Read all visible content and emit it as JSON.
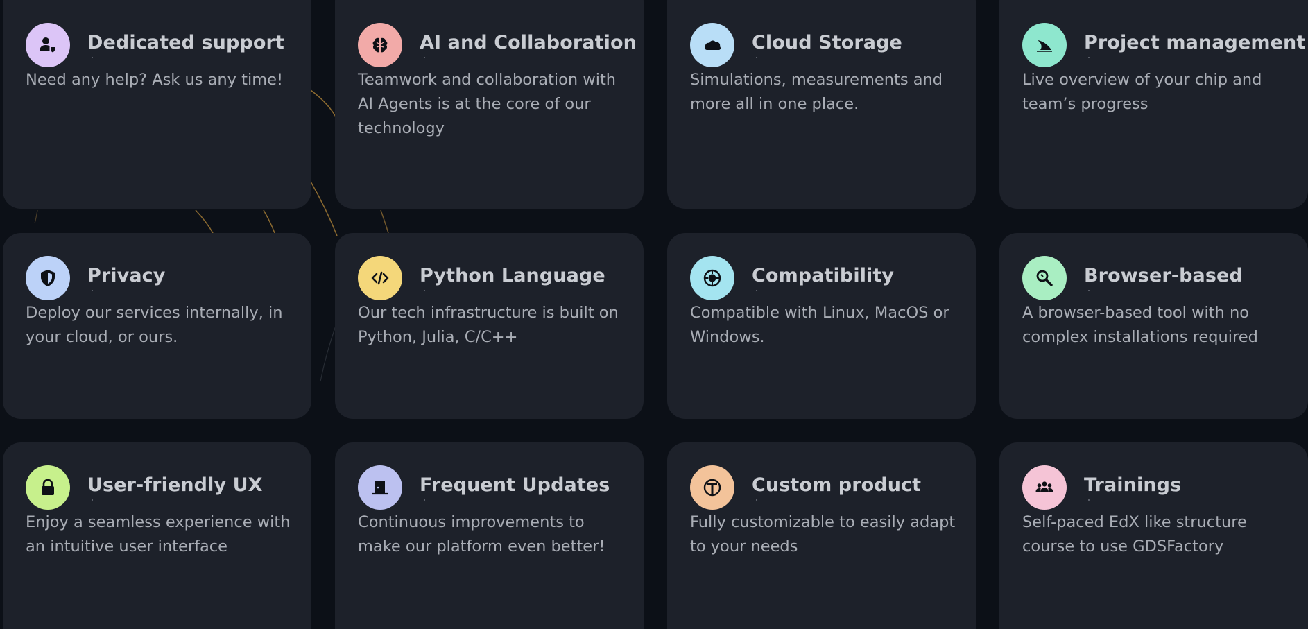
{
  "features": [
    {
      "title": "Dedicated support",
      "desc": "Need any help? Ask us any time!",
      "icon": "user-support-icon",
      "icon_bg": "#dcc5f7"
    },
    {
      "title": "AI and Collaboration",
      "desc": "Teamwork and collaboration with AI Agents is at the core of our technology",
      "icon": "brain-icon",
      "icon_bg": "#f2aaa8"
    },
    {
      "title": "Cloud Storage",
      "desc": "Simulations, measurements and more all in one place.",
      "icon": "cloud-icon",
      "icon_bg": "#b9def7"
    },
    {
      "title": "Project management",
      "desc": "Live overview of your chip and team’s progress",
      "icon": "shark-fin-icon",
      "icon_bg": "#8ee7ce"
    },
    {
      "title": "Privacy",
      "desc": "Deploy our services internally, in your cloud, or ours.",
      "icon": "shield-icon",
      "icon_bg": "#bcd2f8"
    },
    {
      "title": "Python Language",
      "desc": "Our tech infrastructure is built on Python, Julia, C/C++",
      "icon": "code-icon",
      "icon_bg": "#f4d77a"
    },
    {
      "title": "Compatibility",
      "desc": "Compatible with Linux, MacOS or Windows.",
      "icon": "chip-icon",
      "icon_bg": "#a4e4f0"
    },
    {
      "title": "Browser-based",
      "desc": "A browser-based tool with no complex installations required",
      "icon": "search-icon",
      "icon_bg": "#a9eec2"
    },
    {
      "title": "User-friendly UX",
      "desc": "Enjoy a seamless experience with an intuitive user interface",
      "icon": "lock-icon",
      "icon_bg": "#c7f08c"
    },
    {
      "title": "Frequent Updates",
      "desc": "Continuous improvements to make our platform even better!",
      "icon": "door-icon",
      "icon_bg": "#bcc1f0"
    },
    {
      "title": "Custom product",
      "desc": "Fully customizable to easily adapt to your needs",
      "icon": "t-circle-icon",
      "icon_bg": "#f3c39a"
    },
    {
      "title": "Trainings",
      "desc": "Self-paced EdX like structure course to use GDSFactory",
      "icon": "users-icon",
      "icon_bg": "#f5c4d6"
    }
  ],
  "colors": {
    "page_bg": "#0c1017",
    "card_bg": "#1d212a",
    "title_text": "#c9ccd2",
    "desc_text": "#a9adb5",
    "accent_line": "#b8893a",
    "icon_glyph": "#0e1116"
  }
}
